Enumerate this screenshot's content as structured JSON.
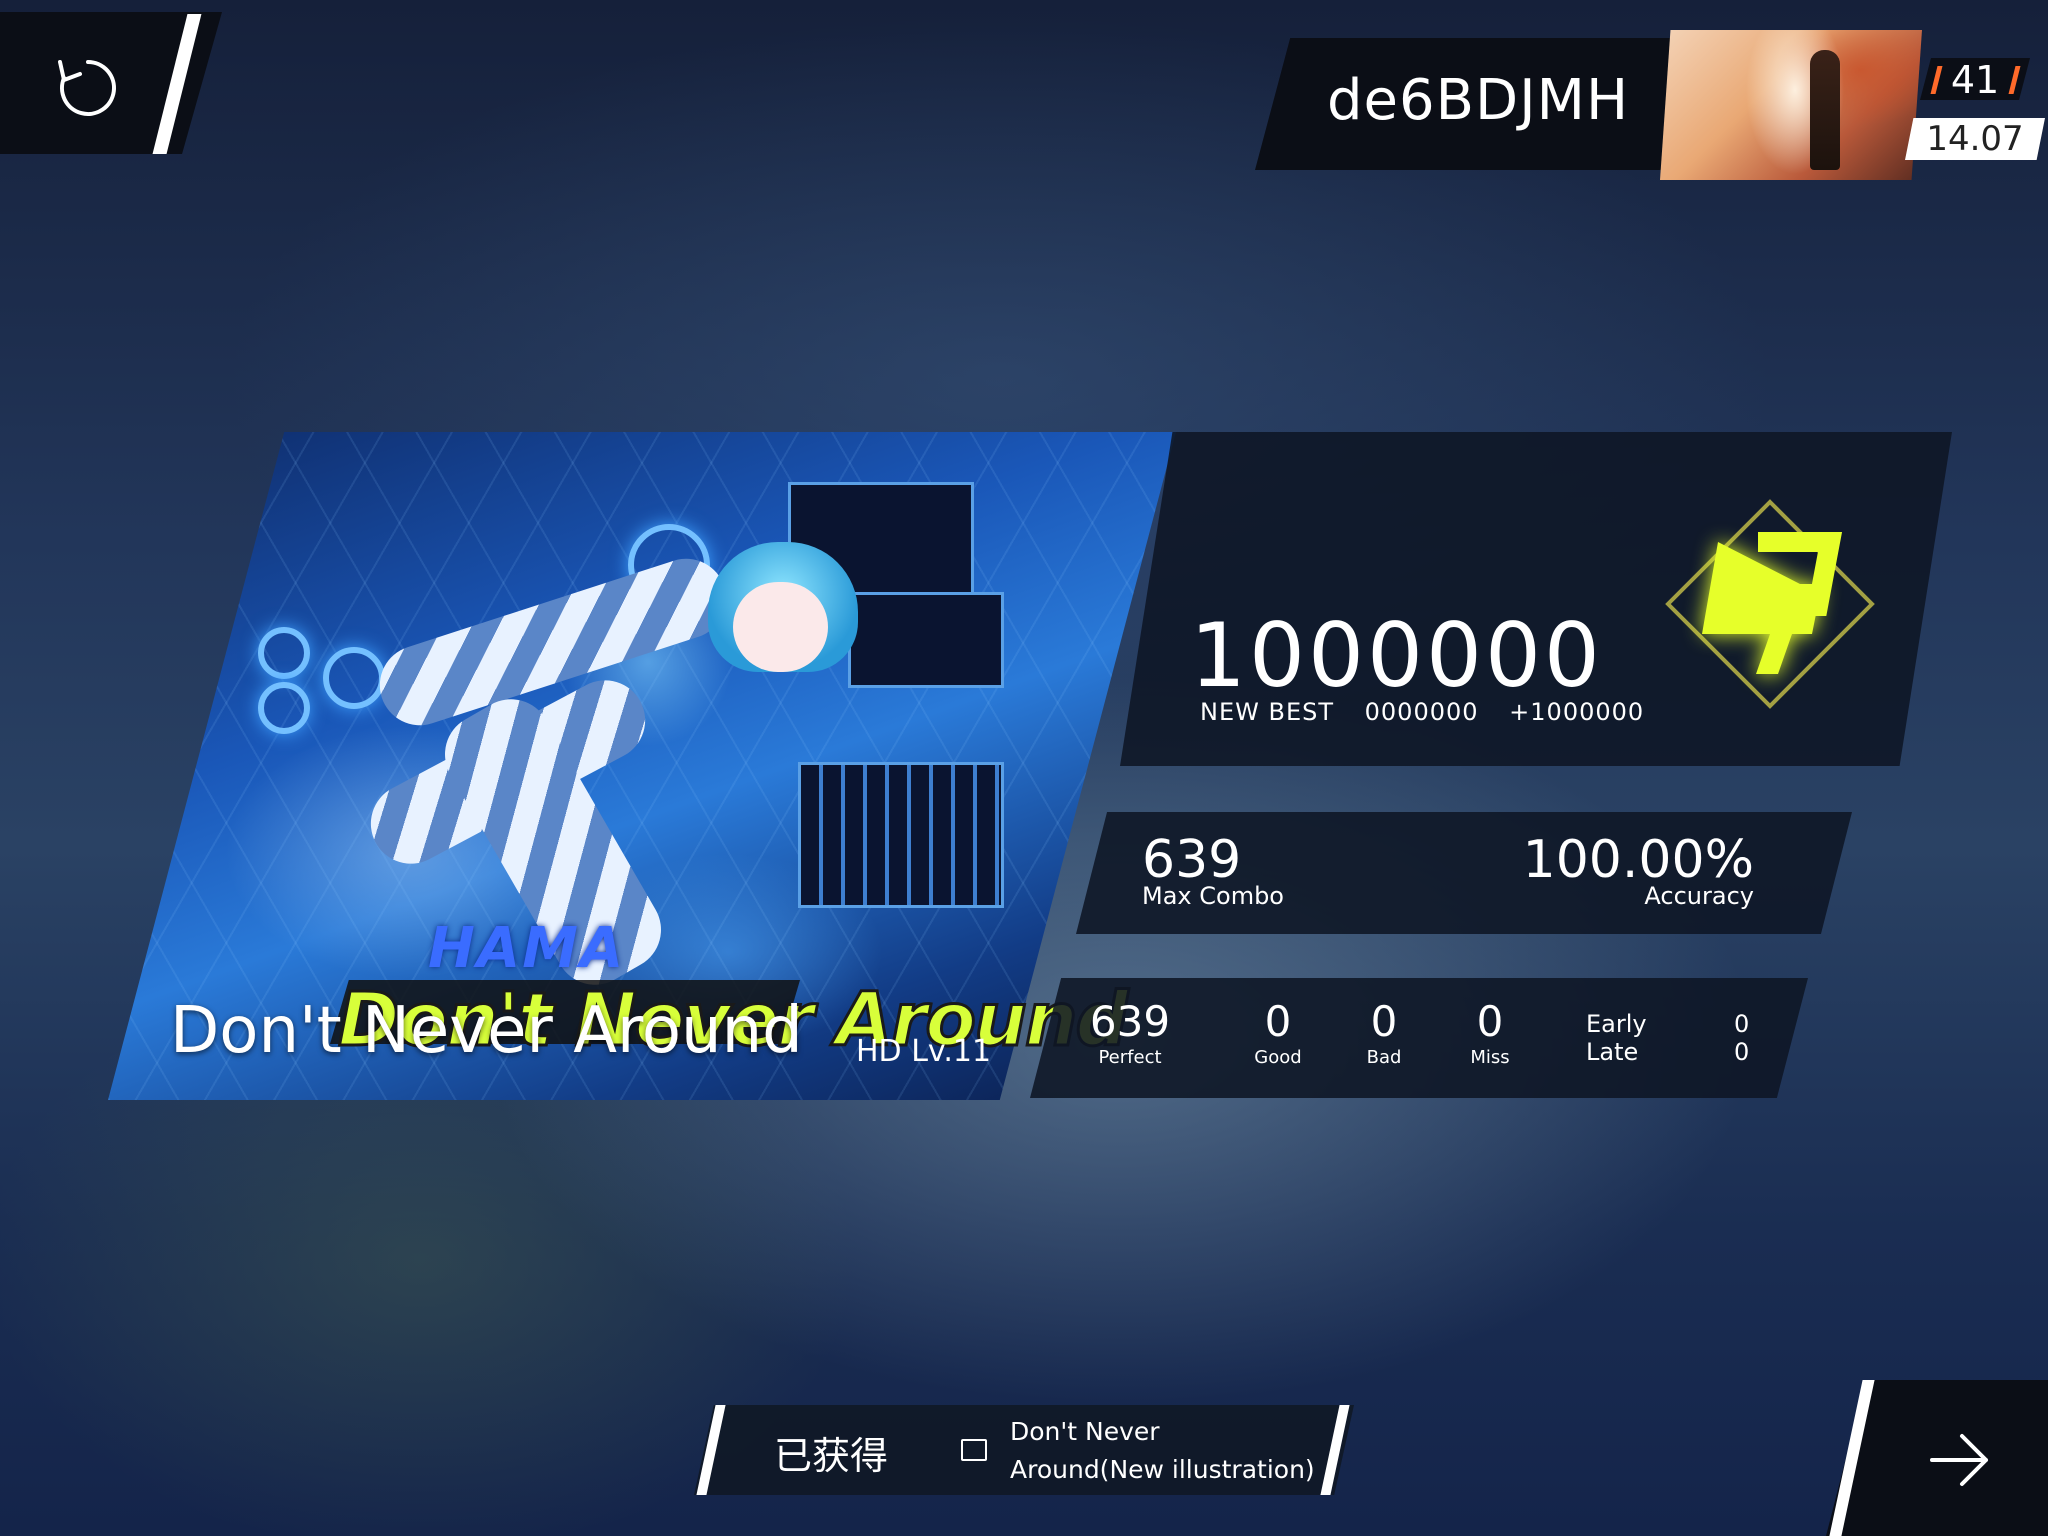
{
  "header": {
    "player_name": "de6BDJMH",
    "rank_level": "41",
    "rks": "14.07"
  },
  "song": {
    "title": "Don't Never Around",
    "difficulty": "HD Lv.11",
    "art_logo_artist": "HAMA",
    "art_logo_title": "Don't Never Around"
  },
  "result": {
    "score": "1000000",
    "new_best_label": "NEW BEST",
    "previous_best": "0000000",
    "score_delta": "+1000000",
    "grade": "φ",
    "max_combo": "639",
    "max_combo_label": "Max Combo",
    "accuracy": "100.00%",
    "accuracy_label": "Accuracy"
  },
  "judgements": {
    "perfect": "639",
    "perfect_label": "Perfect",
    "good": "0",
    "good_label": "Good",
    "bad": "0",
    "bad_label": "Bad",
    "miss": "0",
    "miss_label": "Miss",
    "early_label": "Early",
    "early": "0",
    "late_label": "Late",
    "late": "0"
  },
  "reward": {
    "obtained_label": "已获得",
    "item_line1": "Don't Never",
    "item_line2": "Around(New illustration)"
  },
  "colors": {
    "rank_accent": "#ff6a2a",
    "grade_yellow": "#e6ff2a",
    "panel_dark": "#0e1624"
  },
  "icons": {
    "retry": "retry-icon",
    "next": "arrow-right-icon",
    "reward_item": "image-icon"
  }
}
